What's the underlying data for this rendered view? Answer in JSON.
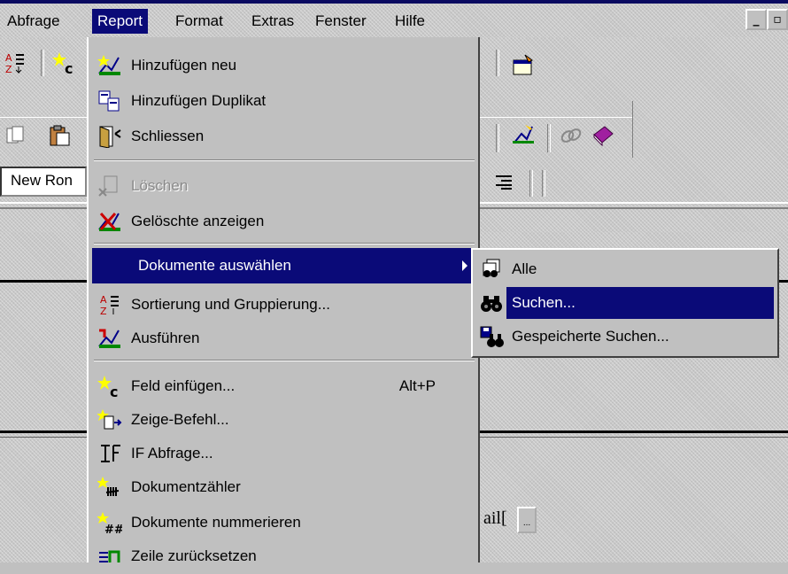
{
  "menubar": {
    "items": [
      {
        "label": "Abfrage",
        "key": "A"
      },
      {
        "label": "Report",
        "key": "R"
      },
      {
        "label": "Format",
        "key": "t"
      },
      {
        "label": "Extras",
        "key": "x"
      },
      {
        "label": "Fenster",
        "key": "F"
      },
      {
        "label": "Hilfe",
        "key": "H"
      }
    ],
    "active": "Report",
    "minimize_glyph": "_",
    "restore_glyph": "▫"
  },
  "font_box": {
    "value": "New Ron"
  },
  "report_menu": {
    "items": [
      {
        "label": "Hinzufügen neu",
        "icon": "add-new-report-icon"
      },
      {
        "label": "Hinzufügen Duplikat",
        "icon": "duplicate-report-icon"
      },
      {
        "label": "Schliessen",
        "icon": "close-report-icon"
      },
      {
        "label": "Löschen",
        "icon": "delete-report-icon",
        "disabled": true
      },
      {
        "label": "Gelöschte anzeigen",
        "icon": "show-deleted-icon"
      },
      {
        "label": "Dokumente auswählen",
        "submenu": true,
        "highlighted": true
      },
      {
        "label": "Sortierung und Gruppierung...",
        "icon": "sort-az-icon"
      },
      {
        "label": "Ausführen",
        "icon": "run-report-icon"
      },
      {
        "label": "Feld einfügen...",
        "icon": "insert-field-icon",
        "shortcut": "Alt+P"
      },
      {
        "label": "Zeige-Befehl...",
        "icon": "show-command-icon"
      },
      {
        "label": "IF Abfrage...",
        "icon": "if-query-icon"
      },
      {
        "label": "Dokumentzähler",
        "icon": "document-counter-icon"
      },
      {
        "label": "Dokumente nummerieren",
        "icon": "number-documents-icon"
      },
      {
        "label": "Zeile zurücksetzen",
        "icon": "reset-line-icon"
      }
    ]
  },
  "submenu": {
    "items": [
      {
        "label": "Alle",
        "icon": "all-documents-icon"
      },
      {
        "label": "Suchen...",
        "icon": "binoculars-icon",
        "highlighted": true
      },
      {
        "label": "Gespeicherte Suchen...",
        "icon": "saved-searches-icon"
      }
    ]
  },
  "document": {
    "text": "ail["
  },
  "colors": {
    "highlight": "#0a0a78",
    "face": "#c0c0c0"
  }
}
